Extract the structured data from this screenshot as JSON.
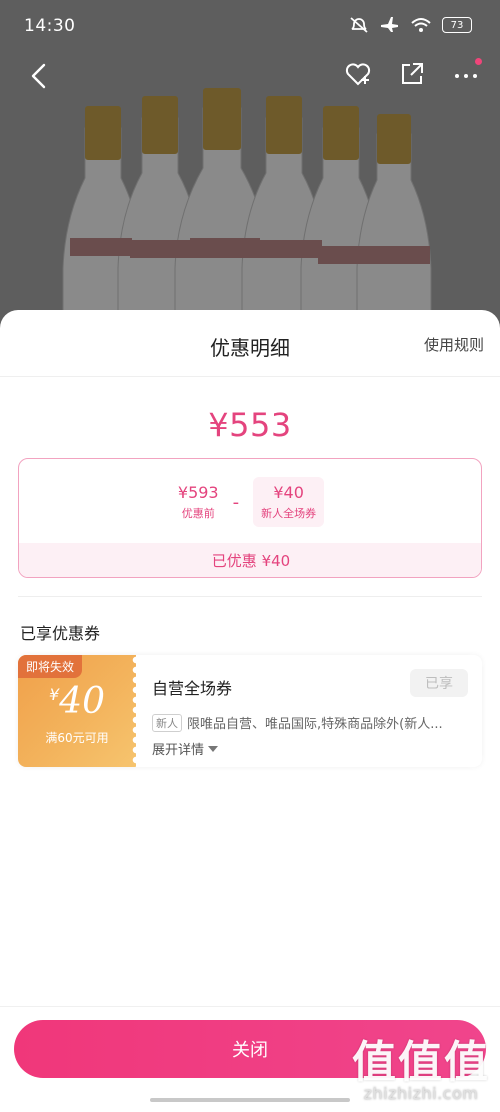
{
  "status_bar": {
    "time": "14:30",
    "battery": "73",
    "icons": [
      "mute-icon",
      "airplane-icon",
      "wifi-icon",
      "battery-icon"
    ]
  },
  "nav": {
    "icons": [
      "back-icon",
      "favorite-add-icon",
      "share-icon",
      "more-icon"
    ]
  },
  "sheet": {
    "title": "优惠明细",
    "rules_link": "使用规则",
    "final_price": "¥553",
    "calc": {
      "original_amount": "¥593",
      "original_label": "优惠前",
      "minus": "-",
      "coupon_amount": "¥40",
      "coupon_label": "新人全场券",
      "saved_text": "已优惠 ¥40"
    },
    "section_title": "已享优惠券",
    "coupon": {
      "expire_tag": "即将失效",
      "yen": "¥",
      "value": "40",
      "condition": "满60元可用",
      "name": "自营全场券",
      "status_button": "已享",
      "new_tag": "新人",
      "description": "限唯品自营、唯品国际,特殊商品除外(新人...",
      "expand": "展开详情"
    },
    "close_button": "关闭"
  },
  "watermark": {
    "big": "值值值",
    "small": "zhizhizhi.com"
  },
  "colors": {
    "accent": "#e4447e",
    "button": "#f0377a",
    "coupon_orange": "#f3b35c"
  }
}
